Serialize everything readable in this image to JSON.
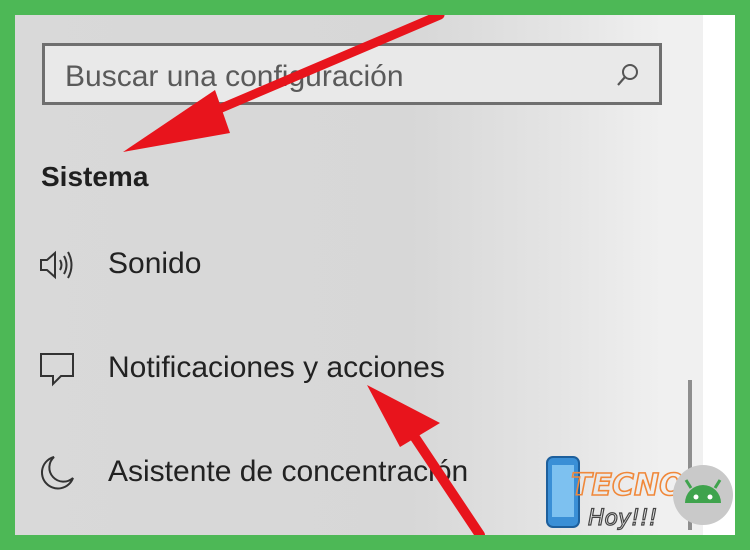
{
  "search": {
    "placeholder": "Buscar una configuración"
  },
  "section": {
    "title": "Sistema"
  },
  "items": [
    {
      "label": "Sonido",
      "icon": "speaker-icon"
    },
    {
      "label": "Notificaciones y acciones",
      "icon": "notification-icon"
    },
    {
      "label": "Asistente de concentración",
      "icon": "moon-icon"
    }
  ],
  "colors": {
    "frame": "#4db856",
    "arrow": "#e8141c",
    "panel": "#d9d9d9"
  },
  "watermark": {
    "line1": "TECNO",
    "line2": "Hoy!!!"
  }
}
